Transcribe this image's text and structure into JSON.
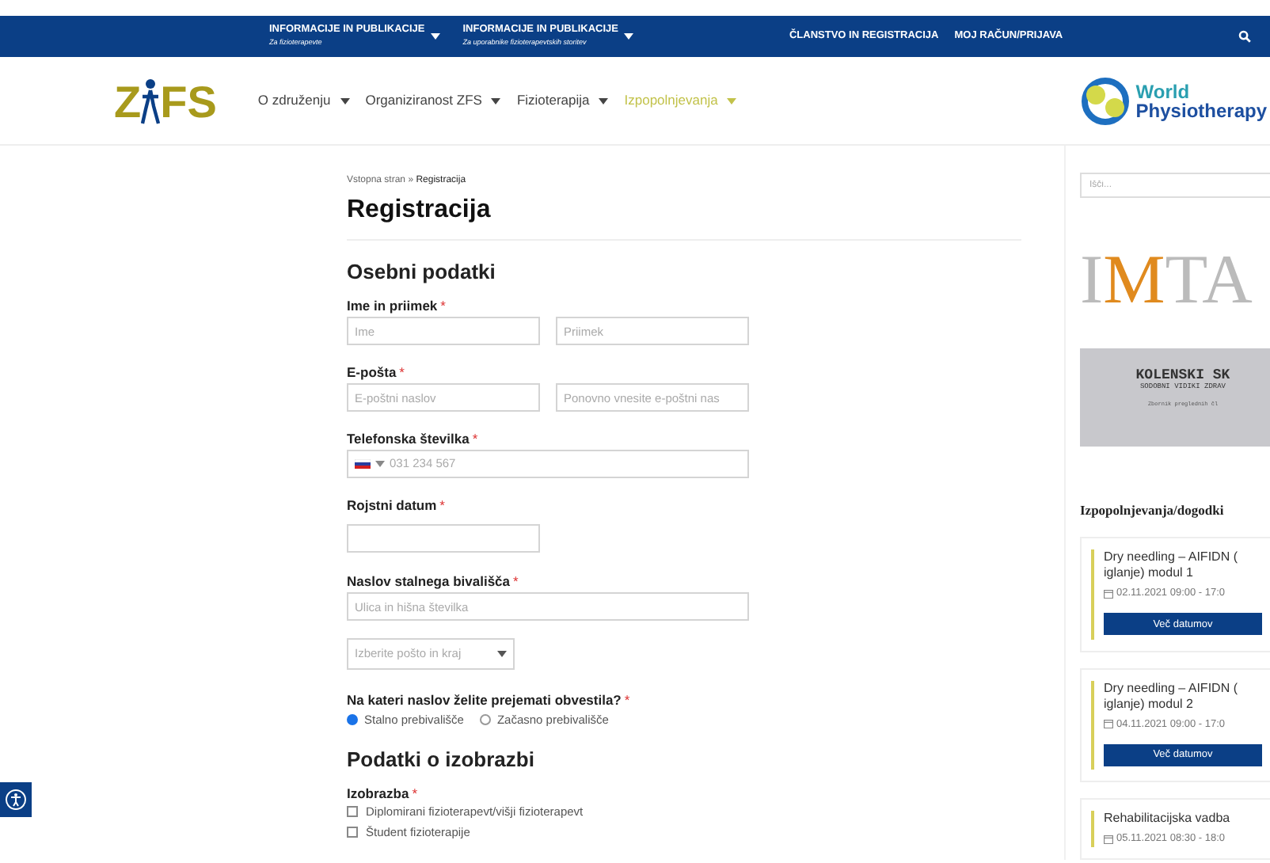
{
  "top_bar": {
    "items": [
      {
        "kind": "dropdown",
        "label": "INFORMACIJE IN PUBLIKACIJE",
        "sub": "Za fizioterapevte"
      },
      {
        "kind": "dropdown",
        "label": "INFORMACIJE IN PUBLIKACIJE",
        "sub": "Za uporabnike fizioterapevtskih storitev"
      },
      {
        "kind": "link",
        "label": "ČLANSTVO IN REGISTRACIJA"
      },
      {
        "kind": "link",
        "label": "MOJ RAČUN/PRIJAVA"
      }
    ]
  },
  "logo": {
    "left": "Z",
    "right": "FS"
  },
  "nav": [
    {
      "label": "O združenju",
      "selected": false
    },
    {
      "label": "Organiziranost ZFS",
      "selected": false
    },
    {
      "label": "Fizioterapija",
      "selected": false
    },
    {
      "label": "Izpopolnjevanja",
      "selected": true
    }
  ],
  "partner_logo": {
    "line1": "World",
    "line2": "Physiotherapy"
  },
  "breadcrumb": {
    "home": "Vstopna stran",
    "sep": "»",
    "current": "Registracija"
  },
  "title": "Registracija",
  "sections": [
    {
      "heading": "Osebni podatki",
      "fields": [
        {
          "kind": "pair",
          "label": "Ime in priimek",
          "required_mark": "*",
          "placeholders": [
            "Ime",
            "Priimek"
          ]
        },
        {
          "kind": "pair",
          "label": "E-pošta",
          "required_mark": "*",
          "placeholders": [
            "E-poštni naslov",
            "Ponovno vnesite e-poštni nas"
          ]
        },
        {
          "kind": "phone",
          "label": "Telefonska številka",
          "required_mark": "*",
          "placeholder": "031 234 567"
        },
        {
          "kind": "short",
          "label": "Rojstni datum",
          "required_mark": "*"
        },
        {
          "kind": "address",
          "label": "Naslov stalnega bivališča",
          "required_mark": "*",
          "placeholder": "Ulica in hišna številka",
          "select": "Izberite pošto in kraj"
        },
        {
          "kind": "radio",
          "label": "Na kateri naslov želite prejemati obvestila?",
          "required_mark": "*",
          "options": [
            {
              "label": "Stalno prebivališče",
              "selected": true
            },
            {
              "label": "Začasno prebivališče",
              "selected": false
            }
          ]
        }
      ]
    },
    {
      "heading": "Podatki o izobrazbi",
      "fields": [
        {
          "kind": "checks",
          "label": "Izobrazba",
          "required_mark": "*",
          "options": [
            {
              "label": "Diplomirani fizioterapevt/višji fizioterapevt",
              "checked": false
            },
            {
              "label": "Študent fizioterapije",
              "checked": false
            }
          ]
        }
      ]
    }
  ],
  "sidebar": {
    "search": {
      "placeholder": "Išči..."
    },
    "banner": {
      "logo_a": "I",
      "logo_b": "M",
      "logo_c": "TA",
      "cover_title": "KOLENSKI SK",
      "cover_sub": "SODOBNI VIDIKI ZDRAV",
      "cover_note": "Zbornik preglednih čl"
    },
    "events_title": "Izpopolnjevanja/dogodki",
    "events": [
      {
        "title": "Dry needling – AIFIDN (",
        "title2": "iglanje) modul 1",
        "date": "02.11.2021 09:00 - 17:0",
        "button": "Več datumov"
      },
      {
        "title": "Dry needling – AIFIDN (",
        "title2": "iglanje) modul 2",
        "date": "04.11.2021 09:00 - 17:0",
        "button": "Več datumov"
      },
      {
        "title": "Rehabilitacijska vadba",
        "date": "05.11.2021 08:30 - 18:0"
      }
    ]
  }
}
